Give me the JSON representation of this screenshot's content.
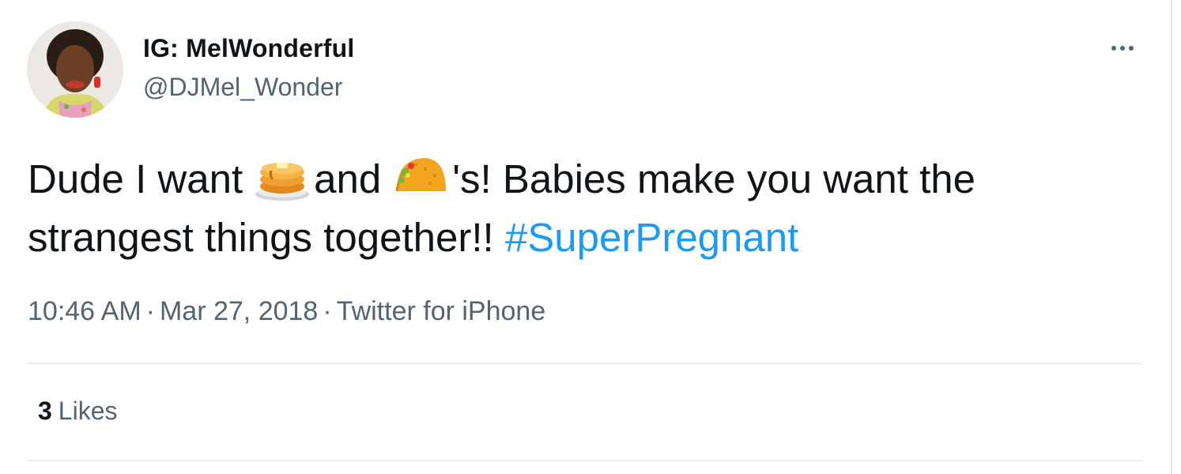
{
  "tweet": {
    "display_name": "IG: MelWonderful",
    "handle": "@DJMel_Wonder",
    "text_part1": "Dude I want",
    "emoji_1": "pancakes-emoji",
    "text_part2": "and",
    "emoji_2": "taco-emoji",
    "text_part3": "'s! Babies make you want the strangest things together!!",
    "hashtag": "#SuperPregnant",
    "time": "10:46 AM",
    "date": "Mar 27, 2018",
    "source": "Twitter for iPhone",
    "separator": "·",
    "likes_count": "3",
    "likes_label": "Likes"
  },
  "colors": {
    "text": "#0f1419",
    "secondary": "#536471",
    "link": "#1d9bf0",
    "divider": "#eceef0"
  }
}
